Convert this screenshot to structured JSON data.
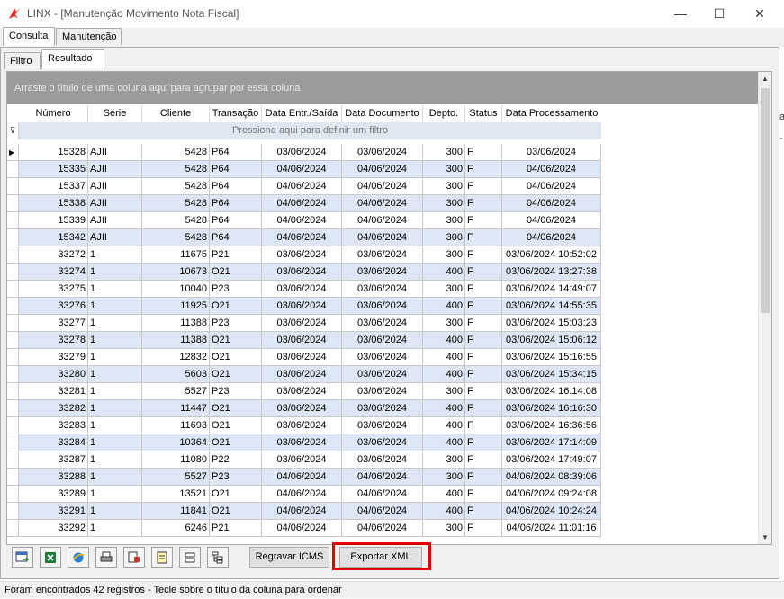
{
  "window": {
    "title": "LINX - [Manutenção Movimento Nota Fiscal]",
    "minimize": "—",
    "maximize": "☐",
    "close": "✕"
  },
  "outer_tabs": [
    "Consulta",
    "Manutenção"
  ],
  "inner_tabs": [
    "Filtro",
    "Resultado"
  ],
  "grid": {
    "group_hint": "Arraste o título de uma coluna aqui para agrupar por essa coluna",
    "filter_hint": "Pressione aqui para definir um filtro",
    "columns": [
      "Número",
      "Série",
      "Cliente",
      "Transação",
      "Data Entr./Saída",
      "Data Documento",
      "Depto.",
      "Status",
      "Data Processamento"
    ],
    "rows": [
      [
        "15328",
        "AJII",
        "5428",
        "P64",
        "03/06/2024",
        "03/06/2024",
        "300",
        "F",
        "03/06/2024"
      ],
      [
        "15335",
        "AJII",
        "5428",
        "P64",
        "04/06/2024",
        "04/06/2024",
        "300",
        "F",
        "04/06/2024"
      ],
      [
        "15337",
        "AJII",
        "5428",
        "P64",
        "04/06/2024",
        "04/06/2024",
        "300",
        "F",
        "04/06/2024"
      ],
      [
        "15338",
        "AJII",
        "5428",
        "P64",
        "04/06/2024",
        "04/06/2024",
        "300",
        "F",
        "04/06/2024"
      ],
      [
        "15339",
        "AJII",
        "5428",
        "P64",
        "04/06/2024",
        "04/06/2024",
        "300",
        "F",
        "04/06/2024"
      ],
      [
        "15342",
        "AJII",
        "5428",
        "P64",
        "04/06/2024",
        "04/06/2024",
        "300",
        "F",
        "04/06/2024"
      ],
      [
        "33272",
        "1",
        "11675",
        "P21",
        "03/06/2024",
        "03/06/2024",
        "300",
        "F",
        "03/06/2024 10:52:02"
      ],
      [
        "33274",
        "1",
        "10673",
        "O21",
        "03/06/2024",
        "03/06/2024",
        "400",
        "F",
        "03/06/2024 13:27:38"
      ],
      [
        "33275",
        "1",
        "10040",
        "P23",
        "03/06/2024",
        "03/06/2024",
        "300",
        "F",
        "03/06/2024 14:49:07"
      ],
      [
        "33276",
        "1",
        "11925",
        "O21",
        "03/06/2024",
        "03/06/2024",
        "400",
        "F",
        "03/06/2024 14:55:35"
      ],
      [
        "33277",
        "1",
        "11388",
        "P23",
        "03/06/2024",
        "03/06/2024",
        "300",
        "F",
        "03/06/2024 15:03:23"
      ],
      [
        "33278",
        "1",
        "11388",
        "O21",
        "03/06/2024",
        "03/06/2024",
        "400",
        "F",
        "03/06/2024 15:06:12"
      ],
      [
        "33279",
        "1",
        "12832",
        "O21",
        "03/06/2024",
        "03/06/2024",
        "400",
        "F",
        "03/06/2024 15:16:55"
      ],
      [
        "33280",
        "1",
        "5603",
        "O21",
        "03/06/2024",
        "03/06/2024",
        "400",
        "F",
        "03/06/2024 15:34:15"
      ],
      [
        "33281",
        "1",
        "5527",
        "P23",
        "03/06/2024",
        "03/06/2024",
        "300",
        "F",
        "03/06/2024 16:14:08"
      ],
      [
        "33282",
        "1",
        "11447",
        "O21",
        "03/06/2024",
        "03/06/2024",
        "400",
        "F",
        "03/06/2024 16:16:30"
      ],
      [
        "33283",
        "1",
        "11693",
        "O21",
        "03/06/2024",
        "03/06/2024",
        "400",
        "F",
        "03/06/2024 16:36:56"
      ],
      [
        "33284",
        "1",
        "10364",
        "O21",
        "03/06/2024",
        "03/06/2024",
        "400",
        "F",
        "03/06/2024 17:14:09"
      ],
      [
        "33287",
        "1",
        "11080",
        "P22",
        "03/06/2024",
        "03/06/2024",
        "300",
        "F",
        "03/06/2024 17:49:07"
      ],
      [
        "33288",
        "1",
        "5527",
        "P23",
        "04/06/2024",
        "04/06/2024",
        "300",
        "F",
        "04/06/2024 08:39:06"
      ],
      [
        "33289",
        "1",
        "13521",
        "O21",
        "04/06/2024",
        "04/06/2024",
        "400",
        "F",
        "04/06/2024 09:24:08"
      ],
      [
        "33291",
        "1",
        "11841",
        "O21",
        "04/06/2024",
        "04/06/2024",
        "400",
        "F",
        "04/06/2024 10:24:24"
      ],
      [
        "33292",
        "1",
        "6246",
        "P21",
        "04/06/2024",
        "04/06/2024",
        "300",
        "F",
        "04/06/2024 11:01:16"
      ]
    ]
  },
  "toolbar": {
    "icons": [
      "export-icon",
      "excel-icon",
      "browser-icon",
      "print-icon",
      "print-preview-icon",
      "document-icon",
      "collapse-icon",
      "tree-icon"
    ],
    "regravar_label": "Regravar ICMS",
    "exportar_label": "Exportar XML"
  },
  "status_text": "Foram encontrados 42 registros  - Tecle sobre o título da coluna para ordenar",
  "colors": {
    "alt_row": "#dce6f4",
    "group_panel": "#9b9b9b",
    "highlight": "#e00000"
  }
}
